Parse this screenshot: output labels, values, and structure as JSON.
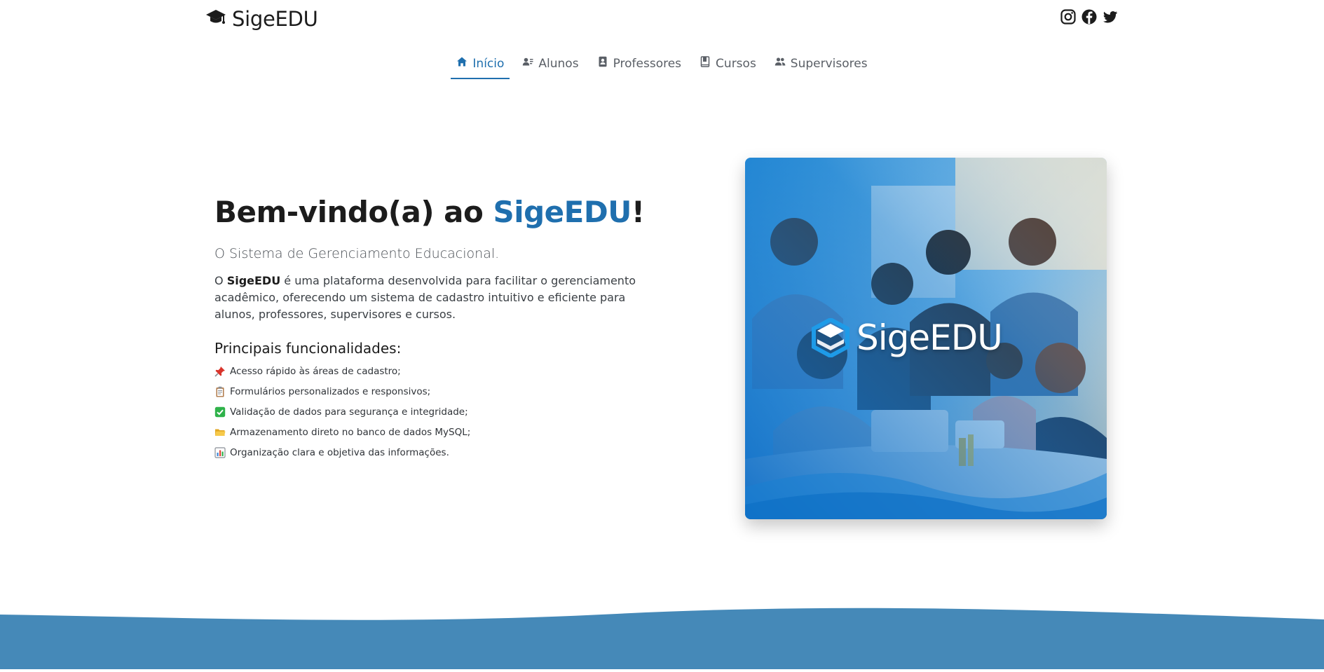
{
  "brand": {
    "name": "SigeEDU",
    "icon": "graduation-cap-icon"
  },
  "social": [
    {
      "name": "instagram-icon",
      "label": "Instagram"
    },
    {
      "name": "facebook-icon",
      "label": "Facebook"
    },
    {
      "name": "twitter-icon",
      "label": "Twitter"
    }
  ],
  "nav": {
    "items": [
      {
        "label": "Início",
        "icon": "home-icon",
        "active": true
      },
      {
        "label": "Alunos",
        "icon": "student-card-icon",
        "active": false
      },
      {
        "label": "Professores",
        "icon": "contact-book-icon",
        "active": false
      },
      {
        "label": "Cursos",
        "icon": "book-icon",
        "active": false
      },
      {
        "label": "Supervisores",
        "icon": "users-icon",
        "active": false
      }
    ]
  },
  "hero": {
    "title_prefix": "Bem-vindo(a) ao ",
    "title_brand": "SigeEDU",
    "title_suffix": "!",
    "subtitle": "O Sistema de Gerenciamento Educacional.",
    "description_prefix": "O ",
    "description_brand": "SigeEDU",
    "description_rest": " é uma plataforma desenvolvida para facilitar o gerenciamento acadêmico, oferecendo um sistema de cadastro intuitivo e eficiente para alunos, professores, supervisores e cursos.",
    "features_title": "Principais funcionalidades:",
    "features": [
      {
        "icon": "pushpin-icon",
        "text": "Acesso rápido às áreas de cadastro;"
      },
      {
        "icon": "clipboard-icon",
        "text": "Formulários personalizados e responsivos;"
      },
      {
        "icon": "check-mark-icon",
        "text": "Validação de dados para segurança e integridade;"
      },
      {
        "icon": "folder-icon",
        "text": "Armazenamento direto no banco de dados MySQL;"
      },
      {
        "icon": "bar-chart-icon",
        "text": "Organização clara e objetiva das informações."
      }
    ],
    "image_logo_text": "SigeEDU"
  },
  "colors": {
    "accent": "#1f6fae",
    "footer": "#4589b8",
    "text": "#212529"
  }
}
